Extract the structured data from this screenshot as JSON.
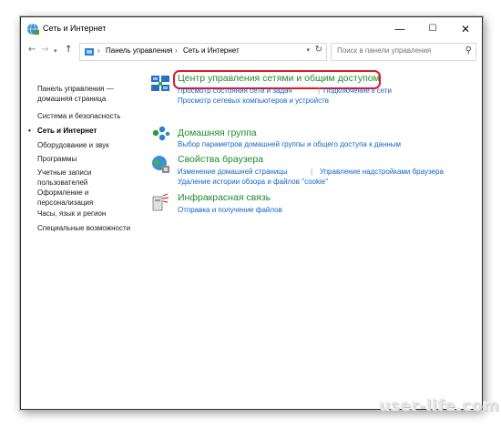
{
  "window": {
    "title": "Сеть и Интернет"
  },
  "controls": {
    "minimize": "—",
    "maximize": "☐",
    "close": "✕"
  },
  "nav": {
    "back": "←",
    "forward": "→",
    "recent": "▾",
    "up": "↑"
  },
  "address": {
    "crumbs": [
      "Панель управления",
      "Сеть и Интернет"
    ],
    "separator": "›",
    "dropdown": "▾",
    "refresh": "↻"
  },
  "search": {
    "placeholder": "Поиск в панели управления",
    "icon": "⚲"
  },
  "sidebar": {
    "items": [
      {
        "label": "Панель управления — домашняя страница"
      },
      {
        "label": "Система и безопасность"
      },
      {
        "label": "Сеть и Интернет",
        "active": true
      },
      {
        "label": "Оборудование и звук"
      },
      {
        "label": "Программы"
      },
      {
        "label": "Учетные записи пользователей"
      },
      {
        "label": "Оформление и персонализация"
      },
      {
        "label": "Часы, язык и регион"
      },
      {
        "label": "Специальные возможности"
      }
    ],
    "bullet": "•"
  },
  "categories": [
    {
      "title": "Центр управления сетями и общим доступом",
      "icon": "network-center-icon",
      "highlighted": true,
      "links": [
        "Просмотр состояния сети и задач",
        "Подключение к сети",
        "Просмотр сетевых компьютеров и устройств"
      ]
    },
    {
      "title": "Домашняя группа",
      "icon": "homegroup-icon",
      "links": [
        "Выбор параметров домашней группы и общего доступа к данным"
      ]
    },
    {
      "title": "Свойства браузера",
      "icon": "browser-properties-icon",
      "links": [
        "Изменение домашней страницы",
        "Управление надстройками браузера",
        "Удаление истории обзора и файлов \"cookie\""
      ]
    },
    {
      "title": "Инфракрасная связь",
      "icon": "infrared-icon",
      "links": [
        "Отправка и получение файлов"
      ]
    }
  ],
  "link_separator": "|",
  "watermark": "user-life.com",
  "colors": {
    "category_title": "#1e8a2e",
    "link": "#1464c8",
    "highlight": "#e0182a"
  }
}
